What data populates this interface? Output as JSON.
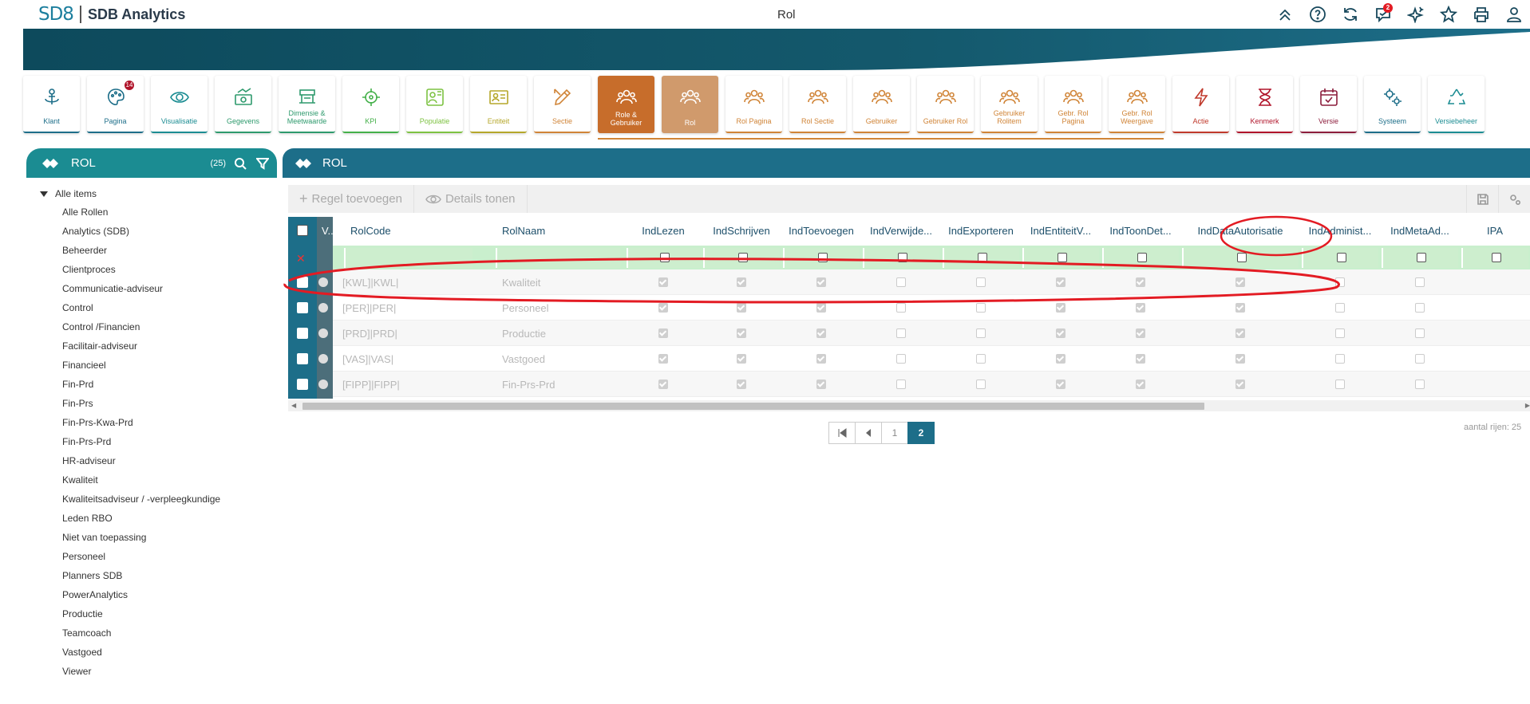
{
  "app": {
    "logo": "SD8",
    "name": "SDB Analytics",
    "page_title": "Rol"
  },
  "top_icons": [
    {
      "name": "collapse-icon"
    },
    {
      "name": "help-icon"
    },
    {
      "name": "refresh-icon"
    },
    {
      "name": "messages-icon",
      "badge": "2"
    },
    {
      "name": "sparkle-icon"
    },
    {
      "name": "star-icon"
    },
    {
      "name": "print-icon"
    },
    {
      "name": "user-icon"
    }
  ],
  "colors": {
    "teal": "#1b8c92",
    "blue": "#1d6e89",
    "orange": "#c76d2b",
    "annotation_red": "#e31b23"
  },
  "ribbon": [
    {
      "label": "Klant",
      "icon": "anchor-icon",
      "color": "#1d6e89"
    },
    {
      "label": "Pagina",
      "icon": "palette-icon",
      "color": "#1d6e89",
      "badge": "14"
    },
    {
      "label": "Visualisatie",
      "icon": "eye-icon",
      "color": "#1b8c92"
    },
    {
      "label": "Gegevens",
      "icon": "money-icon",
      "color": "#2e9a6d"
    },
    {
      "label": "Dimensie & Meetwaarde",
      "icon": "dimension-icon",
      "color": "#2e9a6d"
    },
    {
      "label": "KPI",
      "icon": "target-icon",
      "color": "#44b04a"
    },
    {
      "label": "Populatie",
      "icon": "population-icon",
      "color": "#7dc242"
    },
    {
      "label": "Entiteit",
      "icon": "id-card-icon",
      "color": "#b5a72a"
    },
    {
      "label": "Sectie",
      "icon": "pencil-ruler-icon",
      "color": "#d08437"
    },
    {
      "label": "Role & Gebruiker",
      "icon": "users-icon",
      "color": "#c76d2b",
      "state": "active"
    },
    {
      "label": "Rol",
      "icon": "users-icon",
      "color": "#d09a6c",
      "state": "active2"
    },
    {
      "label": "Rol Pagina",
      "icon": "users-icon",
      "color": "#d08437"
    },
    {
      "label": "Rol Sectie",
      "icon": "users-icon",
      "color": "#d08437"
    },
    {
      "label": "Gebruiker",
      "icon": "users-icon",
      "color": "#d08437"
    },
    {
      "label": "Gebruiker Rol",
      "icon": "users-icon",
      "color": "#d08437"
    },
    {
      "label": "Gebruiker Rolitem",
      "icon": "users-icon",
      "color": "#d08437"
    },
    {
      "label": "Gebr. Rol Pagina",
      "icon": "users-icon",
      "color": "#d08437"
    },
    {
      "label": "Gebr. Rol Weergave",
      "icon": "users-icon",
      "color": "#d08437"
    },
    {
      "label": "Actie",
      "icon": "lightning-icon",
      "color": "#c0392b"
    },
    {
      "label": "Kenmerk",
      "icon": "hourglass-icon",
      "color": "#b0142a"
    },
    {
      "label": "Versie",
      "icon": "calendar-icon",
      "color": "#8c1d3c"
    },
    {
      "label": "Systeem",
      "icon": "gears-icon",
      "color": "#1d6e89"
    },
    {
      "label": "Versiebeheer",
      "icon": "recycle-icon",
      "color": "#1b8c92"
    }
  ],
  "left_panel": {
    "title": "ROL",
    "count": "(25)",
    "root": "Alle items",
    "items": [
      "Alle Rollen",
      "Analytics (SDB)",
      "Beheerder",
      "Clientproces",
      "Communicatie-adviseur",
      "Control",
      "Control /Financien",
      "Facilitair-adviseur",
      "Financieel",
      "Fin-Prd",
      "Fin-Prs",
      "Fin-Prs-Kwa-Prd",
      "Fin-Prs-Prd",
      "HR-adviseur",
      "Kwaliteit",
      "Kwaliteitsadviseur / -verpleegkundige",
      "Leden RBO",
      "Niet van toepassing",
      "Personeel",
      "Planners SDB",
      "PowerAnalytics",
      "Productie",
      "Teamcoach",
      "Vastgoed",
      "Viewer"
    ]
  },
  "right_panel": {
    "title": "ROL",
    "toolbar": {
      "add_label": "Regel toevoegen",
      "details_label": "Details tonen"
    },
    "columns": [
      "V...",
      "RolCode",
      "RolNaam",
      "IndLezen",
      "IndSchrijven",
      "IndToevoegen",
      "IndVerwijde...",
      "IndExporteren",
      "IndEntiteitV...",
      "IndToonDet...",
      "IndDataAutorisatie",
      "IndAdminist...",
      "IndMetaAd...",
      "IPA"
    ],
    "rows": [
      {
        "code": "[KWL]|KWL|",
        "name": "Kwaliteit",
        "flags": [
          1,
          1,
          1,
          0,
          0,
          1,
          1,
          1,
          0,
          0
        ]
      },
      {
        "code": "[PER]|PER|",
        "name": "Personeel",
        "flags": [
          1,
          1,
          1,
          0,
          0,
          1,
          1,
          1,
          0,
          0
        ]
      },
      {
        "code": "[PRD]|PRD|",
        "name": "Productie",
        "flags": [
          1,
          1,
          1,
          0,
          0,
          1,
          1,
          1,
          0,
          0
        ]
      },
      {
        "code": "[VAS]|VAS|",
        "name": "Vastgoed",
        "flags": [
          1,
          1,
          1,
          0,
          0,
          1,
          1,
          1,
          0,
          0
        ]
      },
      {
        "code": "[FIPP]|FIPP|",
        "name": "Fin-Prs-Prd",
        "flags": [
          1,
          1,
          1,
          0,
          0,
          1,
          1,
          1,
          0,
          0
        ]
      }
    ],
    "pager": {
      "pages": [
        "1",
        "2"
      ],
      "current": "2"
    },
    "row_count": "aantal rijen: 25"
  }
}
